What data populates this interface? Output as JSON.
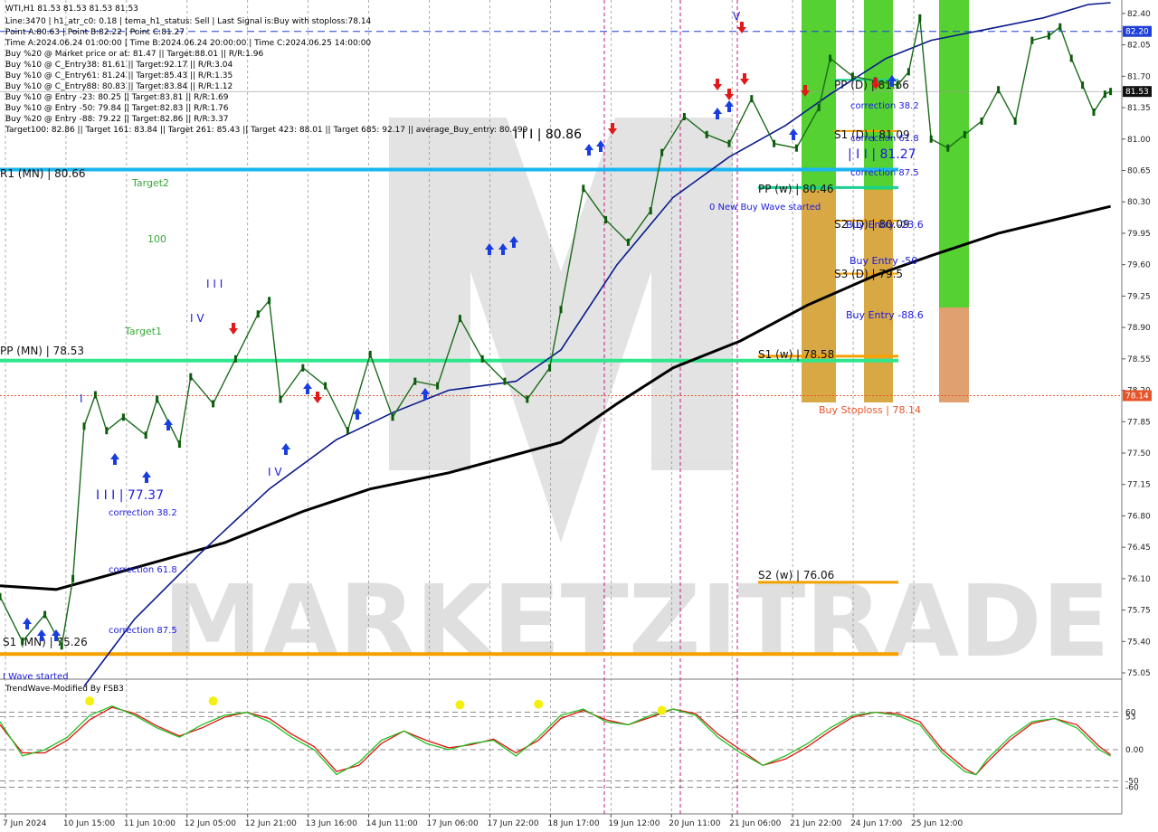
{
  "chart_data": {
    "type": "line",
    "symbol": "WTI,H1",
    "ohlc_header": "WTI,H1  81.53 81.53 81.53 81.53",
    "info_lines": [
      "Line:3470 | h1_atr_c0: 0.18 | tema_h1_status: Sell | Last Signal is:Buy with stoploss:78.14",
      "Point A:80.63 | Point B:82.22 | Point C:81.27",
      "Time A:2024.06.24 01:00:00 | Time B:2024.06.24 20:00:00 | Time C:2024.06.25 14:00:00",
      "Buy %20 @ Market price or at: 81.47 || Target:88.01 || R/R:1.96",
      "Buy %10 @ C_Entry38: 81.61 || Target:92.17 || R/R:3.04",
      "Buy %10 @ C_Entry61: 81.24 || Target:85.43 || R/R:1.35",
      "Buy %10 @ C_Entry88: 80.83 || Target:83.84 || R/R:1.12",
      "Buy %10 @ Entry -23: 80.25 || Target:83.81 || R/R:1.69",
      "Buy %10 @ Entry -50: 79.84 || Target:82.83 || R/R:1.76",
      "Buy %20 @ Entry -88: 79.22 || Target:82.86 || R/R:3.37",
      "Target100: 82.86 || Target 161: 83.84 || Target 261: 85.43 || Target 423: 88.01 || Target 685: 92.17 || average_Buy_entry: 80.499"
    ],
    "y_ticks": [
      "82.40",
      "82.05",
      "81.70",
      "81.35",
      "81.00",
      "80.65",
      "80.30",
      "79.95",
      "79.60",
      "79.25",
      "78.90",
      "78.55",
      "78.20",
      "77.85",
      "77.50",
      "77.15",
      "76.80",
      "76.45",
      "76.10",
      "75.75",
      "75.40",
      "75.05"
    ],
    "ylim": [
      74.99,
      82.55
    ],
    "x_ticks": [
      "7 Jun 2024",
      "10 Jun 15:00",
      "11 Jun 10:00",
      "12 Jun 05:00",
      "12 Jun 21:00",
      "13 Jun 16:00",
      "14 Jun 11:00",
      "17 Jun 06:00",
      "17 Jun 22:00",
      "18 Jun 17:00",
      "19 Jun 12:00",
      "20 Jun 11:00",
      "21 Jun 06:00",
      "21 Jun 22:00",
      "24 Jun 17:00",
      "25 Jun 12:00"
    ],
    "price_tags": [
      {
        "label": "82.20",
        "value": 82.2,
        "color": "#1f3fd8"
      },
      {
        "label": "81.53",
        "value": 81.53,
        "color": "#111111"
      },
      {
        "label": "78.14",
        "value": 78.14,
        "color": "#e8542a"
      }
    ],
    "levels": [
      {
        "label": "R1 (MN) | 80.66",
        "value": 80.66,
        "color": "#19b6f0",
        "start_x": 0.0
      },
      {
        "label": "PP (MN) | 78.53",
        "value": 78.53,
        "color": "#2ee68c",
        "start_x": 0.0
      },
      {
        "label": "S1 (MN) | 75.26",
        "value": 75.26,
        "color": "#f5a000",
        "start_x": 0.0
      },
      {
        "label": "PP (w) | 80.46",
        "value": 80.46,
        "color": "#19d090",
        "start_x": 0.0
      },
      {
        "label": "S1 (w) | 78.58",
        "value": 78.58,
        "color": "#f5a000",
        "start_x": 0.0
      },
      {
        "label": "S2 (w) | 76.06",
        "value": 76.06,
        "color": "#f5a000",
        "start_x": 0.0
      },
      {
        "label": "PP (D) | 81.66",
        "value": 81.66,
        "color": "#19d090",
        "start_x": 0.0
      },
      {
        "label": "S1 (D) | 81.09",
        "value": 81.09,
        "color": "#f5a000",
        "start_x": 0.0
      },
      {
        "label": "S2 (D) | 80.09",
        "value": 80.09,
        "color": "#f5a000",
        "start_x": 0.0
      },
      {
        "label": "S3 (D) | 79.5",
        "value": 79.5,
        "color": "#f5a000",
        "start_x": 0.0
      }
    ],
    "annotations": [
      {
        "text": "Target2",
        "color": "#3aa83a"
      },
      {
        "text": "100",
        "color": "#3aa83a"
      },
      {
        "text": "Target1",
        "color": "#3aa83a"
      },
      {
        "text": "I I I",
        "color": "#1a1ae0"
      },
      {
        "text": "I V",
        "color": "#1a1ae0"
      },
      {
        "text": "I V",
        "color": "#1a1ae0"
      },
      {
        "text": "I",
        "color": "#1a1ae0"
      },
      {
        "text": "I I I | 77.37",
        "color": "#1a1ae0"
      },
      {
        "text": "correction 38.2",
        "color": "#1a1ae0"
      },
      {
        "text": "correction 61.8",
        "color": "#1a1ae0"
      },
      {
        "text": "correction 87.5",
        "color": "#1a1ae0"
      },
      {
        "text": "0 New Buy Wave started",
        "color": "#1a1ae0"
      },
      {
        "text": "| I I | 81.27",
        "color": "#1a1ae0"
      },
      {
        "text": "correction 38.2",
        "color": "#1a1ae0"
      },
      {
        "text": "correction 61.8",
        "color": "#1a1ae0"
      },
      {
        "text": "correction 87.5",
        "color": "#1a1ae0"
      },
      {
        "text": "Buy Entry -23.6",
        "color": "#1a1ae0"
      },
      {
        "text": "Buy Entry -50",
        "color": "#1a1ae0"
      },
      {
        "text": "Buy Entry -88.6",
        "color": "#1a1ae0"
      },
      {
        "text": "Buy Stoploss | 78.14",
        "color": "#e8542a"
      },
      {
        "text": "I Wave started",
        "color": "#1a1ae0"
      },
      {
        "text": "I I I | 80.86",
        "color": "#000000"
      },
      {
        "text": "V",
        "color": "#1a1ae0"
      }
    ],
    "ma_black": [
      [
        0.0,
        76.02
      ],
      [
        0.05,
        75.98
      ],
      [
        0.1,
        76.15
      ],
      [
        0.2,
        76.5
      ],
      [
        0.27,
        76.85
      ],
      [
        0.33,
        77.1
      ],
      [
        0.4,
        77.28
      ],
      [
        0.45,
        77.45
      ],
      [
        0.5,
        77.62
      ],
      [
        0.55,
        78.05
      ],
      [
        0.6,
        78.45
      ],
      [
        0.66,
        78.75
      ],
      [
        0.72,
        79.15
      ],
      [
        0.78,
        79.48
      ],
      [
        0.83,
        79.7
      ],
      [
        0.89,
        79.95
      ],
      [
        0.99,
        80.25
      ]
    ],
    "ma_blue": [
      [
        0.075,
        74.9
      ],
      [
        0.12,
        75.65
      ],
      [
        0.18,
        76.4
      ],
      [
        0.24,
        77.1
      ],
      [
        0.3,
        77.65
      ],
      [
        0.35,
        77.95
      ],
      [
        0.4,
        78.2
      ],
      [
        0.46,
        78.3
      ],
      [
        0.5,
        78.65
      ],
      [
        0.55,
        79.6
      ],
      [
        0.6,
        80.35
      ],
      [
        0.65,
        80.8
      ],
      [
        0.7,
        81.15
      ],
      [
        0.74,
        81.5
      ],
      [
        0.79,
        81.9
      ],
      [
        0.83,
        82.1
      ],
      [
        0.89,
        82.25
      ],
      [
        0.93,
        82.35
      ],
      [
        0.97,
        82.5
      ],
      [
        0.99,
        82.52
      ]
    ],
    "price": [
      [
        0.0,
        75.9
      ],
      [
        0.02,
        75.4
      ],
      [
        0.04,
        75.7
      ],
      [
        0.055,
        75.35
      ],
      [
        0.065,
        76.1
      ],
      [
        0.075,
        77.8
      ],
      [
        0.085,
        78.15
      ],
      [
        0.095,
        77.75
      ],
      [
        0.11,
        77.9
      ],
      [
        0.13,
        77.7
      ],
      [
        0.14,
        78.1
      ],
      [
        0.16,
        77.6
      ],
      [
        0.17,
        78.35
      ],
      [
        0.19,
        78.05
      ],
      [
        0.21,
        78.55
      ],
      [
        0.23,
        79.05
      ],
      [
        0.24,
        79.2
      ],
      [
        0.25,
        78.1
      ],
      [
        0.27,
        78.45
      ],
      [
        0.29,
        78.25
      ],
      [
        0.31,
        77.75
      ],
      [
        0.33,
        78.6
      ],
      [
        0.35,
        77.9
      ],
      [
        0.37,
        78.3
      ],
      [
        0.39,
        78.25
      ],
      [
        0.41,
        79.0
      ],
      [
        0.43,
        78.55
      ],
      [
        0.45,
        78.3
      ],
      [
        0.47,
        78.1
      ],
      [
        0.49,
        78.45
      ],
      [
        0.5,
        79.1
      ],
      [
        0.52,
        80.45
      ],
      [
        0.54,
        80.1
      ],
      [
        0.56,
        79.85
      ],
      [
        0.58,
        80.2
      ],
      [
        0.59,
        80.85
      ],
      [
        0.61,
        81.25
      ],
      [
        0.63,
        81.05
      ],
      [
        0.65,
        80.95
      ],
      [
        0.67,
        81.45
      ],
      [
        0.69,
        80.95
      ],
      [
        0.71,
        80.9
      ],
      [
        0.73,
        81.35
      ],
      [
        0.74,
        81.9
      ],
      [
        0.76,
        81.7
      ],
      [
        0.78,
        81.65
      ],
      [
        0.8,
        81.6
      ],
      [
        0.81,
        81.75
      ],
      [
        0.82,
        82.35
      ],
      [
        0.83,
        81.0
      ],
      [
        0.845,
        80.9
      ],
      [
        0.86,
        81.05
      ],
      [
        0.875,
        81.2
      ],
      [
        0.89,
        81.55
      ],
      [
        0.905,
        81.2
      ],
      [
        0.92,
        82.1
      ],
      [
        0.935,
        82.15
      ],
      [
        0.945,
        82.25
      ],
      [
        0.955,
        81.9
      ],
      [
        0.965,
        81.6
      ],
      [
        0.975,
        81.3
      ],
      [
        0.985,
        81.5
      ],
      [
        0.99,
        81.53
      ]
    ],
    "oscillator": {
      "title": "TrendWave-Modified By FSB3",
      "ticks": [
        {
          "label": "60",
          "value": 60
        },
        {
          "label": "53",
          "value": 53
        },
        {
          "label": "0.00",
          "value": 0
        },
        {
          "label": "-50",
          "value": -50
        },
        {
          "label": "-60",
          "value": -60
        }
      ],
      "range": [
        -100,
        100
      ],
      "green": [
        [
          0.0,
          45
        ],
        [
          0.02,
          -10
        ],
        [
          0.04,
          0
        ],
        [
          0.06,
          20
        ],
        [
          0.08,
          55
        ],
        [
          0.1,
          70
        ],
        [
          0.12,
          55
        ],
        [
          0.14,
          35
        ],
        [
          0.16,
          20
        ],
        [
          0.18,
          40
        ],
        [
          0.2,
          55
        ],
        [
          0.22,
          60
        ],
        [
          0.24,
          45
        ],
        [
          0.26,
          20
        ],
        [
          0.28,
          0
        ],
        [
          0.3,
          -40
        ],
        [
          0.32,
          -20
        ],
        [
          0.34,
          15
        ],
        [
          0.36,
          30
        ],
        [
          0.38,
          10
        ],
        [
          0.4,
          0
        ],
        [
          0.42,
          10
        ],
        [
          0.44,
          15
        ],
        [
          0.46,
          -10
        ],
        [
          0.48,
          20
        ],
        [
          0.5,
          55
        ],
        [
          0.52,
          65
        ],
        [
          0.54,
          45
        ],
        [
          0.56,
          40
        ],
        [
          0.58,
          55
        ],
        [
          0.6,
          65
        ],
        [
          0.62,
          55
        ],
        [
          0.64,
          20
        ],
        [
          0.66,
          -5
        ],
        [
          0.68,
          -25
        ],
        [
          0.7,
          -10
        ],
        [
          0.72,
          10
        ],
        [
          0.74,
          35
        ],
        [
          0.76,
          55
        ],
        [
          0.78,
          60
        ],
        [
          0.8,
          55
        ],
        [
          0.82,
          40
        ],
        [
          0.84,
          -5
        ],
        [
          0.86,
          -35
        ],
        [
          0.87,
          -40
        ],
        [
          0.88,
          -15
        ],
        [
          0.9,
          20
        ],
        [
          0.92,
          45
        ],
        [
          0.94,
          50
        ],
        [
          0.96,
          35
        ],
        [
          0.98,
          0
        ],
        [
          0.99,
          -10
        ]
      ],
      "red": [
        [
          0.0,
          40
        ],
        [
          0.02,
          -5
        ],
        [
          0.04,
          -5
        ],
        [
          0.06,
          15
        ],
        [
          0.08,
          48
        ],
        [
          0.1,
          68
        ],
        [
          0.12,
          58
        ],
        [
          0.14,
          38
        ],
        [
          0.16,
          22
        ],
        [
          0.18,
          35
        ],
        [
          0.2,
          52
        ],
        [
          0.22,
          60
        ],
        [
          0.24,
          50
        ],
        [
          0.26,
          25
        ],
        [
          0.28,
          5
        ],
        [
          0.3,
          -35
        ],
        [
          0.32,
          -25
        ],
        [
          0.34,
          10
        ],
        [
          0.36,
          30
        ],
        [
          0.38,
          15
        ],
        [
          0.4,
          3
        ],
        [
          0.42,
          8
        ],
        [
          0.44,
          17
        ],
        [
          0.46,
          -5
        ],
        [
          0.48,
          15
        ],
        [
          0.5,
          50
        ],
        [
          0.52,
          63
        ],
        [
          0.54,
          48
        ],
        [
          0.56,
          40
        ],
        [
          0.58,
          52
        ],
        [
          0.6,
          65
        ],
        [
          0.62,
          58
        ],
        [
          0.64,
          25
        ],
        [
          0.66,
          0
        ],
        [
          0.68,
          -25
        ],
        [
          0.7,
          -15
        ],
        [
          0.72,
          5
        ],
        [
          0.74,
          30
        ],
        [
          0.76,
          52
        ],
        [
          0.78,
          60
        ],
        [
          0.8,
          58
        ],
        [
          0.82,
          45
        ],
        [
          0.84,
          0
        ],
        [
          0.86,
          -30
        ],
        [
          0.87,
          -40
        ],
        [
          0.88,
          -20
        ],
        [
          0.9,
          15
        ],
        [
          0.92,
          42
        ],
        [
          0.94,
          50
        ],
        [
          0.96,
          40
        ],
        [
          0.98,
          5
        ],
        [
          0.99,
          -8
        ]
      ],
      "dots": [
        [
          0.08,
          78
        ],
        [
          0.19,
          78
        ],
        [
          0.41,
          72
        ],
        [
          0.48,
          73
        ],
        [
          0.59,
          63
        ]
      ]
    },
    "watermark": "MARKETZITRADE"
  }
}
